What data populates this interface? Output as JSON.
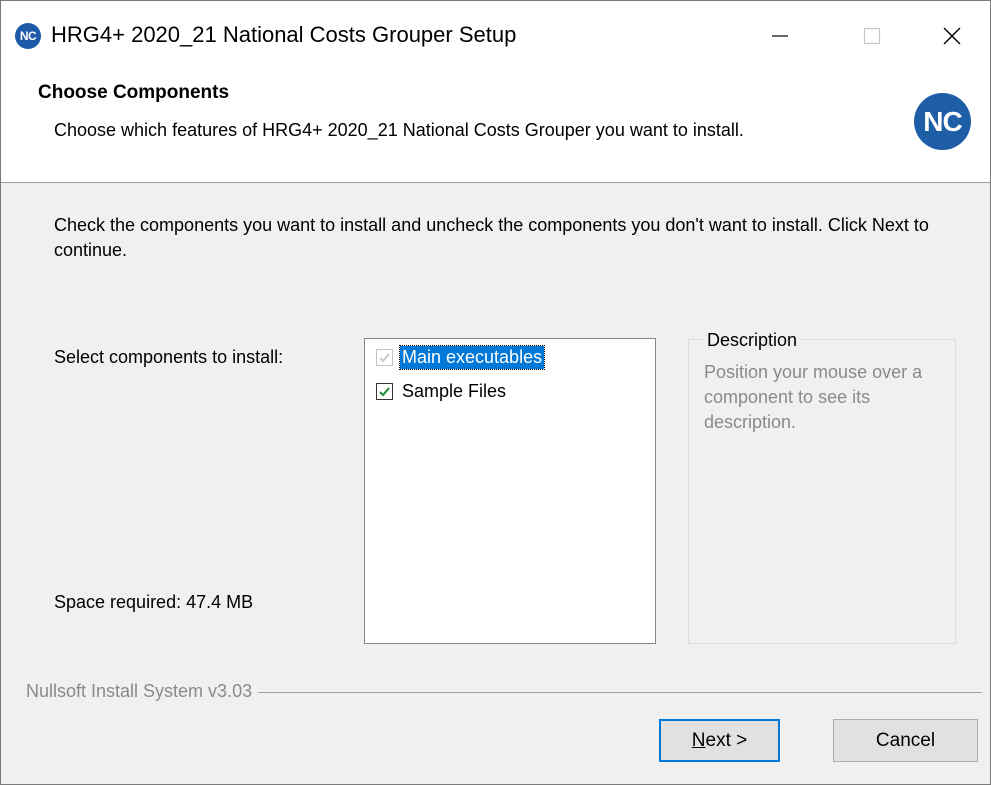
{
  "window": {
    "title": "HRG4+ 2020_21 National Costs Grouper Setup",
    "icon_text": "NC",
    "controls": {
      "minimize": "minimize-icon",
      "maximize": "maximize-icon",
      "close": "close-icon"
    }
  },
  "header": {
    "title": "Choose Components",
    "subtitle": "Choose which features of HRG4+ 2020_21 National Costs Grouper you want to install.",
    "logo_text": "NC"
  },
  "body": {
    "intro": "Check the components you want to install and uncheck the components you don't want to install. Click Next to continue.",
    "select_label": "Select components to install:",
    "space_required": "Space required: 47.4 MB",
    "components": [
      {
        "label": "Main executables",
        "checked": true,
        "disabled": true,
        "selected": true
      },
      {
        "label": "Sample Files",
        "checked": true,
        "disabled": false,
        "selected": false
      }
    ],
    "description": {
      "legend": "Description",
      "text": "Position your mouse over a component to see its description."
    }
  },
  "footer": {
    "branding": "Nullsoft Install System v3.03",
    "next_label": "Next >",
    "cancel_label": "Cancel"
  },
  "colors": {
    "accent": "#0078d7",
    "logo_blue": "#1d5ea6",
    "check_green": "#1e8a35"
  }
}
